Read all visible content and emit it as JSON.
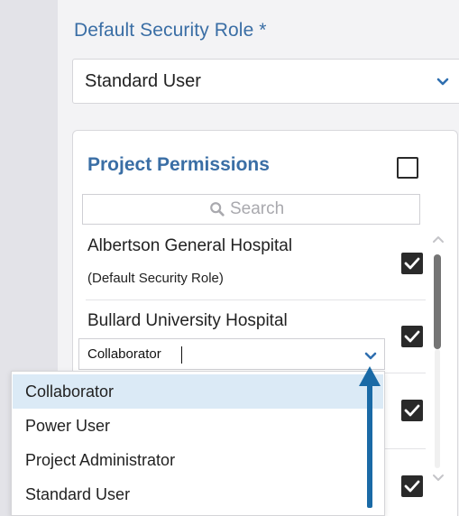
{
  "form": {
    "default_role_label": "Default Security Role *",
    "default_role_value": "Standard User"
  },
  "permissions": {
    "title": "Project Permissions",
    "select_all_checked": false,
    "search_placeholder": "Search",
    "rows": [
      {
        "name": "Albertson General Hospital",
        "sub": "(Default Security Role)",
        "checked": true
      },
      {
        "name": "Bullard University Hospital",
        "role_value": "Collaborator",
        "checked": true
      },
      {
        "name": "",
        "checked": true
      },
      {
        "name": "",
        "checked": true
      }
    ]
  },
  "dropdown": {
    "options": [
      "Collaborator",
      "Power User",
      "Project Administrator",
      "Standard User"
    ],
    "selected": "Collaborator"
  },
  "colors": {
    "accent": "#3a6ea5",
    "arrow": "#1a6aa6",
    "checkbox": "#2a2a2a",
    "highlight": "#dbeaf6"
  }
}
